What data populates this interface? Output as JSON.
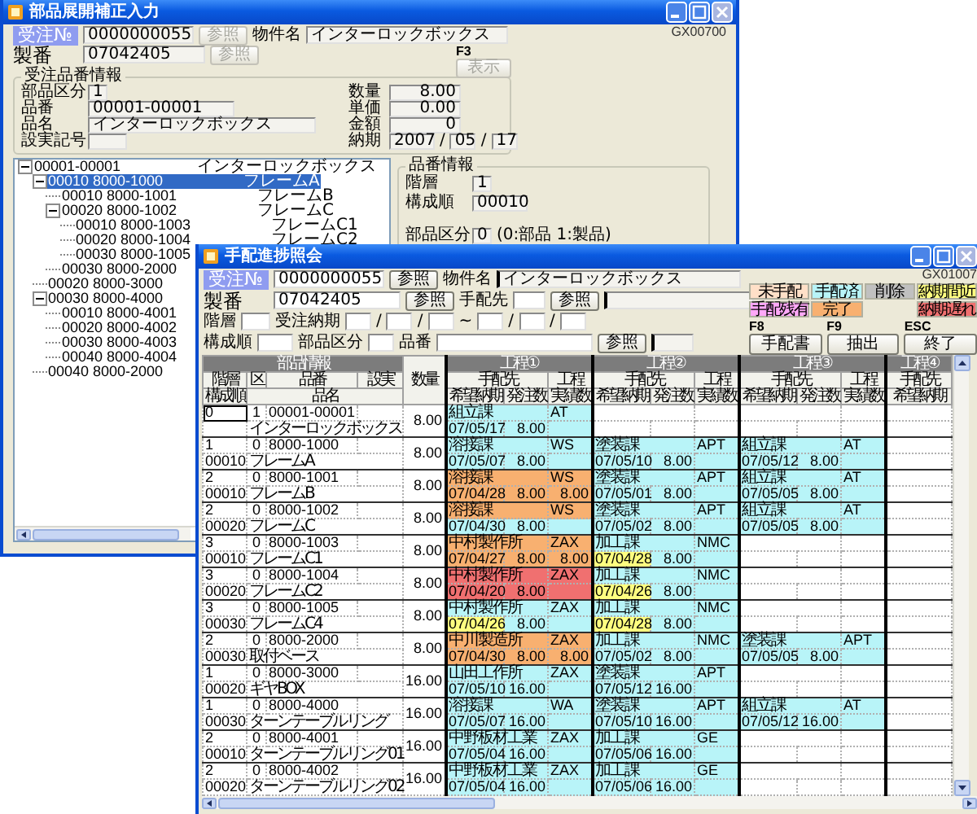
{
  "back_window": {
    "title": "部品展開補正入力",
    "code": "GX00700",
    "order_no": {
      "label": "受注№",
      "value": "0000000055",
      "button": {
        "label": "参照",
        "disabled": true
      }
    },
    "project": {
      "label": "物件名",
      "value": "インターロックボックス"
    },
    "serial": {
      "label": "製番",
      "value": "07042405",
      "button": {
        "label": "参照",
        "disabled": true
      }
    },
    "show_button": {
      "key": "F3",
      "label": "表示",
      "disabled": true
    },
    "order_part_info": {
      "title": "受注品番情報",
      "left_fields": [
        {
          "label": "部品区分",
          "value": "1"
        },
        {
          "label": "品番",
          "value": "00001-00001"
        },
        {
          "label": "品名",
          "value": "インターロックボックス"
        },
        {
          "label": "設実記号"
        }
      ],
      "right_fields": [
        {
          "label": "数量",
          "value": "8.00"
        },
        {
          "label": "単価",
          "value": "0.00"
        },
        {
          "label": "金額",
          "value": "0"
        }
      ],
      "due": {
        "label": "納期",
        "parts": [
          {
            "kind": "field",
            "text": "2007"
          },
          {
            "kind": "sep",
            "text": "/"
          },
          {
            "kind": "field",
            "text": "05"
          },
          {
            "kind": "sep",
            "text": "/"
          },
          {
            "kind": "field",
            "text": "17"
          }
        ]
      }
    },
    "tree": [
      {
        "code": "00001-00001",
        "name": "インターロックボックス",
        "expanded": true,
        "selected": false,
        "children": [
          {
            "code": "00010 8000-1000",
            "name": "フレームA",
            "expanded": true,
            "selected": true,
            "children": [
              {
                "code": "00010 8000-1001",
                "name": "フレームB",
                "selected": false
              },
              {
                "code": "00020 8000-1002",
                "name": "フレームC",
                "expanded": true,
                "selected": false,
                "children": [
                  {
                    "code": "00010 8000-1003",
                    "name": "フレームC1",
                    "selected": false
                  },
                  {
                    "code": "00020 8000-1004",
                    "name": "フレームC2",
                    "selected": false
                  },
                  {
                    "code": "00030 8000-1005",
                    "selected": false
                  }
                ]
              },
              {
                "code": "00030 8000-2000",
                "selected": false
              }
            ]
          },
          {
            "code": "00020 8000-3000",
            "selected": false
          },
          {
            "code": "00030 8000-4000",
            "expanded": true,
            "selected": false,
            "children": [
              {
                "code": "00010 8000-4001",
                "selected": false
              },
              {
                "code": "00020 8000-4002",
                "selected": false
              },
              {
                "code": "00030 8000-4003",
                "selected": false
              },
              {
                "code": "00040 8000-4004",
                "selected": false
              }
            ]
          },
          {
            "code": "00040 8000-2000",
            "selected": false
          }
        ]
      }
    ],
    "part_info": {
      "title": "品番情報",
      "fields": [
        {
          "label": "階層",
          "value": "1"
        },
        {
          "label": "構成順",
          "value": "00010"
        },
        {
          "label": "部品区分",
          "value": "0",
          "note": "(0:部品 1:製品)"
        }
      ]
    }
  },
  "front_window": {
    "title": "手配進捗照会",
    "code": "GX01007",
    "order_no": {
      "label": "受注№",
      "value": "0000000055",
      "button": {
        "label": "参照",
        "disabled": false
      }
    },
    "project": {
      "label": "物件名",
      "value": "インターロックボックス"
    },
    "serial": {
      "label": "製番",
      "value": "07042405",
      "button": {
        "label": "参照",
        "disabled": false
      }
    },
    "vendor": {
      "label": "手配先",
      "button": {
        "label": "参照",
        "disabled": false
      }
    },
    "level": {
      "label": "階層"
    },
    "order_due": {
      "label": "受注納期",
      "parts": [
        {
          "kind": "field"
        },
        {
          "kind": "sep",
          "text": "/"
        },
        {
          "kind": "field"
        },
        {
          "kind": "sep",
          "text": "/"
        },
        {
          "kind": "field"
        },
        {
          "kind": "range",
          "text": "~"
        },
        {
          "kind": "field"
        },
        {
          "kind": "sep",
          "text": "/"
        },
        {
          "kind": "field"
        },
        {
          "kind": "sep",
          "text": "/"
        },
        {
          "kind": "field"
        }
      ]
    },
    "sequence": {
      "label": "構成順"
    },
    "part_type": {
      "label": "部品区分"
    },
    "part_no": {
      "label": "品番",
      "button": {
        "label": "参照",
        "disabled": false
      }
    },
    "legend": [
      [
        {
          "label": "未手配",
          "color": "#ffe0c8"
        },
        {
          "label": "手配済",
          "color": "#b8f4f8"
        },
        {
          "label": "削除",
          "color": "#c0c0c0"
        },
        {
          "label": "納期間近",
          "color": "#ffff80"
        }
      ],
      [
        {
          "label": "手配残有",
          "color": "#ffa8f8"
        },
        {
          "label": "完了",
          "color": "#f8b070"
        },
        {
          "label": "納期遅れ",
          "color": "#f07070"
        }
      ]
    ],
    "buttons": [
      {
        "key": "F8",
        "label": "手配書"
      },
      {
        "key": "F9",
        "label": "抽出"
      },
      {
        "key": "ESC",
        "label": "終了"
      }
    ],
    "grid": {
      "part_header": {
        "title": "部品情報",
        "top": [
          "階層",
          "区",
          "品番",
          "設実"
        ],
        "bottom": [
          "構成順",
          "品名"
        ]
      },
      "qty": "数量",
      "processes": [
        {
          "title": "工程①",
          "vendor": "手配先",
          "process": "工程",
          "columns": [
            "希望納期",
            "発注数",
            "実績数"
          ]
        },
        {
          "title": "工程②",
          "vendor": "手配先",
          "process": "工程",
          "columns": [
            "希望納期",
            "発注数",
            "実績数"
          ]
        },
        {
          "title": "工程③",
          "vendor": "手配先",
          "process": "工程",
          "columns": [
            "希望納期",
            "発注数",
            "実績数"
          ]
        },
        {
          "title": "工程④",
          "vendor": "手配先",
          "columns": [
            "希望納期"
          ]
        }
      ],
      "rows": [
        {
          "level": "0",
          "type": "1",
          "part_no": "00001-00001",
          "name": "インターロックボックス",
          "qty": "8.00",
          "selected": true,
          "processes": [
            {
              "vendor": "組立課",
              "process": "AT",
              "due": "07/05/17",
              "ordered": "8.00",
              "color": "#b8f4f8",
              "due_alert": false
            }
          ]
        },
        {
          "level": "1",
          "type": "0",
          "part_no": "8000-1000",
          "seq": "00010",
          "name": "フレームA",
          "qty": "8.00",
          "selected": false,
          "processes": [
            {
              "vendor": "溶接課",
              "process": "WS",
              "due": "07/05/07",
              "ordered": "8.00",
              "color": "#b8f4f8",
              "due_alert": false
            },
            {
              "vendor": "塗装課",
              "process": "APT",
              "due": "07/05/10",
              "ordered": "8.00",
              "color": "#b8f4f8",
              "due_alert": false
            },
            {
              "vendor": "組立課",
              "process": "AT",
              "due": "07/05/12",
              "ordered": "8.00",
              "color": "#b8f4f8",
              "due_alert": false
            }
          ]
        },
        {
          "level": "2",
          "type": "0",
          "part_no": "8000-1001",
          "seq": "00010",
          "name": "フレームB",
          "qty": "8.00",
          "selected": false,
          "processes": [
            {
              "vendor": "溶接課",
              "process": "WS",
              "due": "07/04/28",
              "ordered": "8.00",
              "actual": "8.00",
              "color": "#f8b070",
              "due_alert": false
            },
            {
              "vendor": "塗装課",
              "process": "APT",
              "due": "07/05/01",
              "ordered": "8.00",
              "color": "#b8f4f8",
              "due_alert": false
            },
            {
              "vendor": "組立課",
              "process": "AT",
              "due": "07/05/05",
              "ordered": "8.00",
              "color": "#b8f4f8",
              "due_alert": false
            }
          ]
        },
        {
          "level": "2",
          "type": "0",
          "part_no": "8000-1002",
          "seq": "00020",
          "name": "フレームC",
          "qty": "8.00",
          "selected": false,
          "processes": [
            {
              "vendor": "溶接課",
              "process": "WS",
              "due": "07/04/30",
              "ordered": "8.00",
              "color": "#f8b070",
              "lower": {
                "color": "#b8f4f8"
              },
              "due_alert": false
            },
            {
              "vendor": "塗装課",
              "process": "APT",
              "due": "07/05/02",
              "ordered": "8.00",
              "color": "#b8f4f8",
              "due_alert": false
            },
            {
              "vendor": "組立課",
              "process": "AT",
              "due": "07/05/05",
              "ordered": "8.00",
              "color": "#b8f4f8",
              "due_alert": false
            }
          ]
        },
        {
          "level": "3",
          "type": "0",
          "part_no": "8000-1003",
          "seq": "00010",
          "name": "フレームC1",
          "qty": "8.00",
          "selected": false,
          "processes": [
            {
              "vendor": "中村製作所",
              "process": "ZAX",
              "due": "07/04/27",
              "ordered": "8.00",
              "actual": "8.00",
              "color": "#f8b070",
              "due_alert": false
            },
            {
              "vendor": "加工課",
              "process": "NMC",
              "due": "07/04/28",
              "ordered": "8.00",
              "color": "#b8f4f8",
              "due_alert": true
            }
          ]
        },
        {
          "level": "3",
          "type": "0",
          "part_no": "8000-1004",
          "seq": "00020",
          "name": "フレームC2",
          "qty": "8.00",
          "selected": false,
          "processes": [
            {
              "vendor": "中村製作所",
              "process": "ZAX",
              "due": "07/04/20",
              "ordered": "8.00",
              "color": "#f07070",
              "due_alert": false
            },
            {
              "vendor": "加工課",
              "process": "NMC",
              "due": "07/04/26",
              "ordered": "8.00",
              "color": "#b8f4f8",
              "due_alert": true
            }
          ]
        },
        {
          "level": "3",
          "type": "0",
          "part_no": "8000-1005",
          "seq": "00030",
          "name": "フレームC4",
          "qty": "8.00",
          "selected": false,
          "processes": [
            {
              "vendor": "中村製作所",
              "process": "ZAX",
              "due": "07/04/26",
              "ordered": "8.00",
              "color": "#b8f4f8",
              "due_alert": true
            },
            {
              "vendor": "加工課",
              "process": "NMC",
              "due": "07/04/28",
              "ordered": "8.00",
              "color": "#b8f4f8",
              "due_alert": true
            }
          ]
        },
        {
          "level": "2",
          "type": "0",
          "part_no": "8000-2000",
          "seq": "00030",
          "name": "取付ベース",
          "qty": "8.00",
          "selected": false,
          "processes": [
            {
              "vendor": "中川製造所",
              "process": "ZAX",
              "due": "07/04/30",
              "ordered": "8.00",
              "actual": "8.00",
              "color": "#f8b070",
              "due_alert": false
            },
            {
              "vendor": "加工課",
              "process": "NMC",
              "due": "07/05/02",
              "ordered": "8.00",
              "color": "#b8f4f8",
              "due_alert": false
            },
            {
              "vendor": "塗装課",
              "process": "APT",
              "due": "07/05/05",
              "ordered": "8.00",
              "color": "#b8f4f8",
              "due_alert": false
            }
          ]
        },
        {
          "level": "1",
          "type": "0",
          "part_no": "8000-3000",
          "seq": "00020",
          "name": "ギヤBOX",
          "qty": "16.00",
          "selected": false,
          "processes": [
            {
              "vendor": "山田工作所",
              "process": "ZAX",
              "due": "07/05/10",
              "ordered": "16.00",
              "color": "#b8f4f8",
              "due_alert": false
            },
            {
              "vendor": "塗装課",
              "process": "APT",
              "due": "07/05/12",
              "ordered": "16.00",
              "color": "#b8f4f8",
              "due_alert": false
            }
          ]
        },
        {
          "level": "1",
          "type": "0",
          "part_no": "8000-4000",
          "seq": "00030",
          "name": "ターンテーブルリング",
          "qty": "16.00",
          "selected": false,
          "processes": [
            {
              "vendor": "溶接課",
              "process": "WA",
              "due": "07/05/07",
              "ordered": "16.00",
              "color": "#b8f4f8",
              "due_alert": false
            },
            {
              "vendor": "塗装課",
              "process": "APT",
              "due": "07/05/10",
              "ordered": "16.00",
              "color": "#b8f4f8",
              "due_alert": false
            },
            {
              "vendor": "組立課",
              "process": "AT",
              "due": "07/05/12",
              "ordered": "16.00",
              "color": "#b8f4f8",
              "due_alert": false
            }
          ]
        },
        {
          "level": "2",
          "type": "0",
          "part_no": "8000-4001",
          "seq": "00010",
          "name": "ターンテーブルリング01",
          "qty": "16.00",
          "selected": false,
          "processes": [
            {
              "vendor": "中野板材工業",
              "process": "ZAX",
              "due": "07/05/04",
              "ordered": "16.00",
              "color": "#b8f4f8",
              "due_alert": false
            },
            {
              "vendor": "加工課",
              "process": "GE",
              "due": "07/05/06",
              "ordered": "16.00",
              "color": "#b8f4f8",
              "due_alert": false
            }
          ]
        },
        {
          "level": "2",
          "type": "0",
          "part_no": "8000-4002",
          "seq": "00020",
          "name": "ターンテーブルリング02",
          "qty": "16.00",
          "selected": false,
          "processes": [
            {
              "vendor": "中野板材工業",
              "process": "ZAX",
              "due": "07/05/04",
              "ordered": "16.00",
              "color": "#b8f4f8",
              "due_alert": false
            },
            {
              "vendor": "加工課",
              "process": "GE",
              "due": "07/05/06",
              "ordered": "16.00",
              "color": "#b8f4f8",
              "due_alert": false
            }
          ]
        }
      ]
    }
  }
}
